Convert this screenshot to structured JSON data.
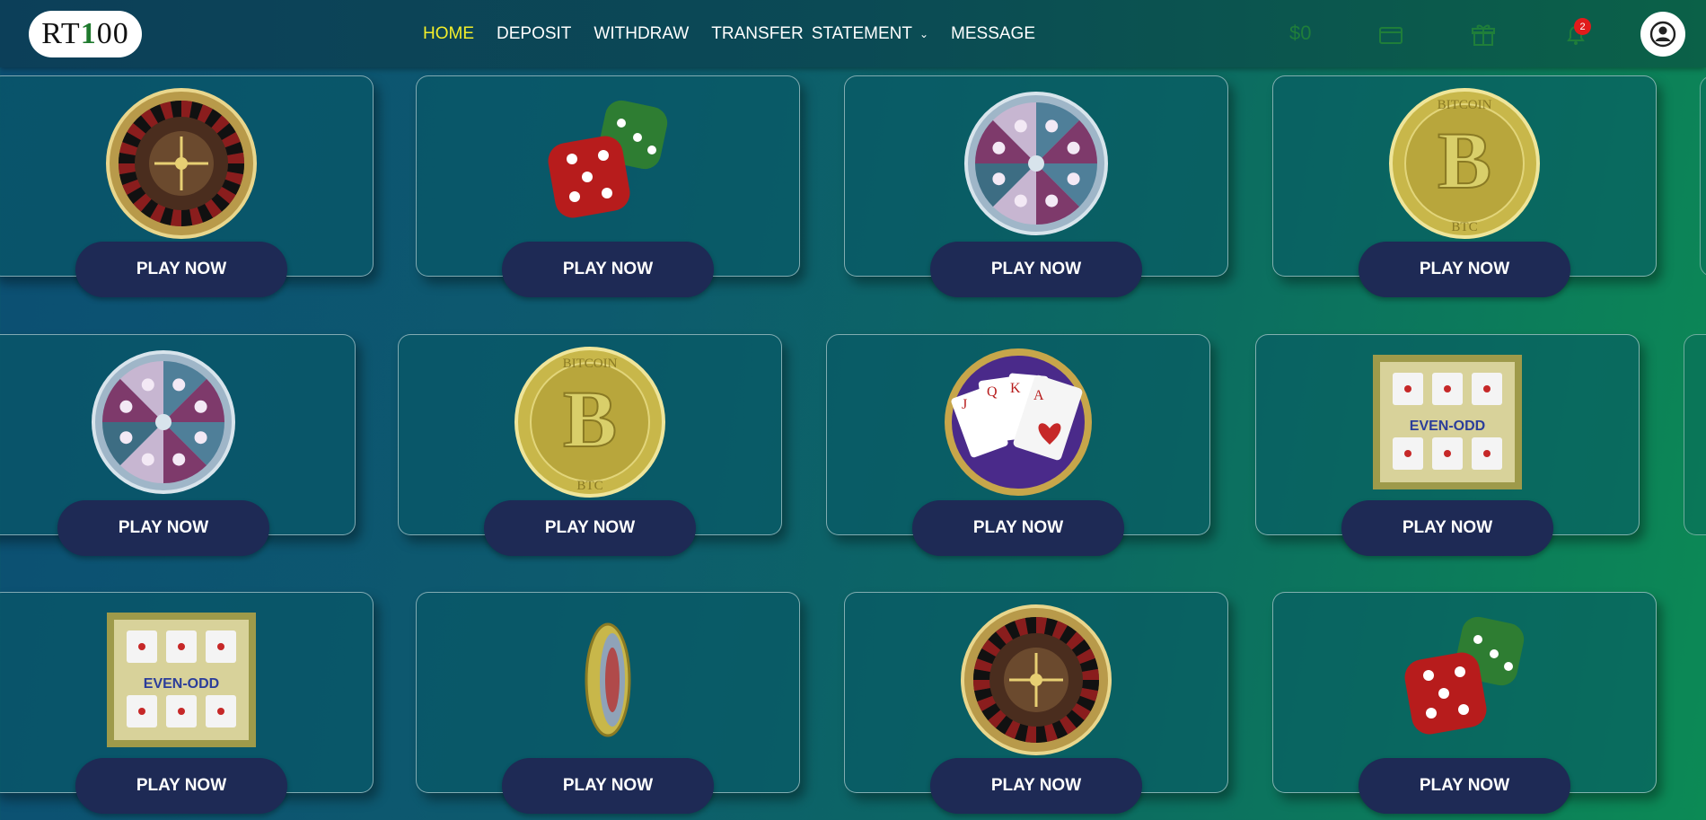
{
  "logo": {
    "text_a": "RT",
    "text_b": "1",
    "text_c": "00"
  },
  "nav": {
    "home": "HOME",
    "deposit": "DEPOSIT",
    "withdraw": "WITHDRAW",
    "transfer": "TRANSFER",
    "statement": "STATEMENT",
    "message": "MESSAGE"
  },
  "header": {
    "balance": "$0",
    "notification_count": "2"
  },
  "colors": {
    "active_nav": "#f3ee2a",
    "button_bg": "#1e2a55",
    "badge": "#e11b1b"
  },
  "games": [
    {
      "icon": "roulette-wheel-icon",
      "button": "PLAY NOW"
    },
    {
      "icon": "dice-icon",
      "button": "PLAY NOW"
    },
    {
      "icon": "fortune-wheel-icon",
      "button": "PLAY NOW"
    },
    {
      "icon": "bitcoin-coin-icon",
      "button": "PLAY NOW"
    },
    {
      "icon": "fortune-wheel-icon",
      "button": "PLAY NOW"
    },
    {
      "icon": "bitcoin-coin-icon",
      "button": "PLAY NOW"
    },
    {
      "icon": "playing-cards-icon",
      "button": "PLAY NOW"
    },
    {
      "icon": "even-odd-board-icon",
      "button": "PLAY NOW"
    },
    {
      "icon": "even-odd-board-icon",
      "button": "PLAY NOW"
    },
    {
      "icon": "flipping-coin-icon",
      "button": "PLAY NOW"
    },
    {
      "icon": "roulette-wheel-icon",
      "button": "PLAY NOW"
    },
    {
      "icon": "dice-icon",
      "button": "PLAY NOW"
    }
  ],
  "even_odd_label": "EVEN-ODD",
  "coin_label_top": "BITCOIN",
  "coin_label_bottom": "BTC"
}
